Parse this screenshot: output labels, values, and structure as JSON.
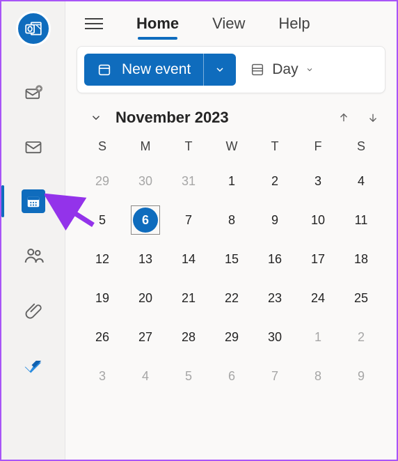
{
  "tabs": {
    "home": "Home",
    "view": "View",
    "help": "Help"
  },
  "toolbar": {
    "new_event": "New event",
    "day": "Day"
  },
  "calendar": {
    "title": "November 2023",
    "dow": [
      "S",
      "M",
      "T",
      "W",
      "T",
      "F",
      "S"
    ],
    "weeks": [
      [
        {
          "n": "29",
          "m": true
        },
        {
          "n": "30",
          "m": true
        },
        {
          "n": "31",
          "m": true
        },
        {
          "n": "1"
        },
        {
          "n": "2"
        },
        {
          "n": "3"
        },
        {
          "n": "4"
        }
      ],
      [
        {
          "n": "5"
        },
        {
          "n": "6",
          "today": true
        },
        {
          "n": "7"
        },
        {
          "n": "8"
        },
        {
          "n": "9"
        },
        {
          "n": "10"
        },
        {
          "n": "11"
        }
      ],
      [
        {
          "n": "12"
        },
        {
          "n": "13"
        },
        {
          "n": "14"
        },
        {
          "n": "15"
        },
        {
          "n": "16"
        },
        {
          "n": "17"
        },
        {
          "n": "18"
        }
      ],
      [
        {
          "n": "19"
        },
        {
          "n": "20"
        },
        {
          "n": "21"
        },
        {
          "n": "22"
        },
        {
          "n": "23"
        },
        {
          "n": "24"
        },
        {
          "n": "25"
        }
      ],
      [
        {
          "n": "26"
        },
        {
          "n": "27"
        },
        {
          "n": "28"
        },
        {
          "n": "29"
        },
        {
          "n": "30"
        },
        {
          "n": "1",
          "m": true
        },
        {
          "n": "2",
          "m": true
        }
      ],
      [
        {
          "n": "3",
          "m": true
        },
        {
          "n": "4",
          "m": true
        },
        {
          "n": "5",
          "m": true
        },
        {
          "n": "6",
          "m": true
        },
        {
          "n": "7",
          "m": true
        },
        {
          "n": "8",
          "m": true
        },
        {
          "n": "9",
          "m": true
        }
      ]
    ]
  }
}
